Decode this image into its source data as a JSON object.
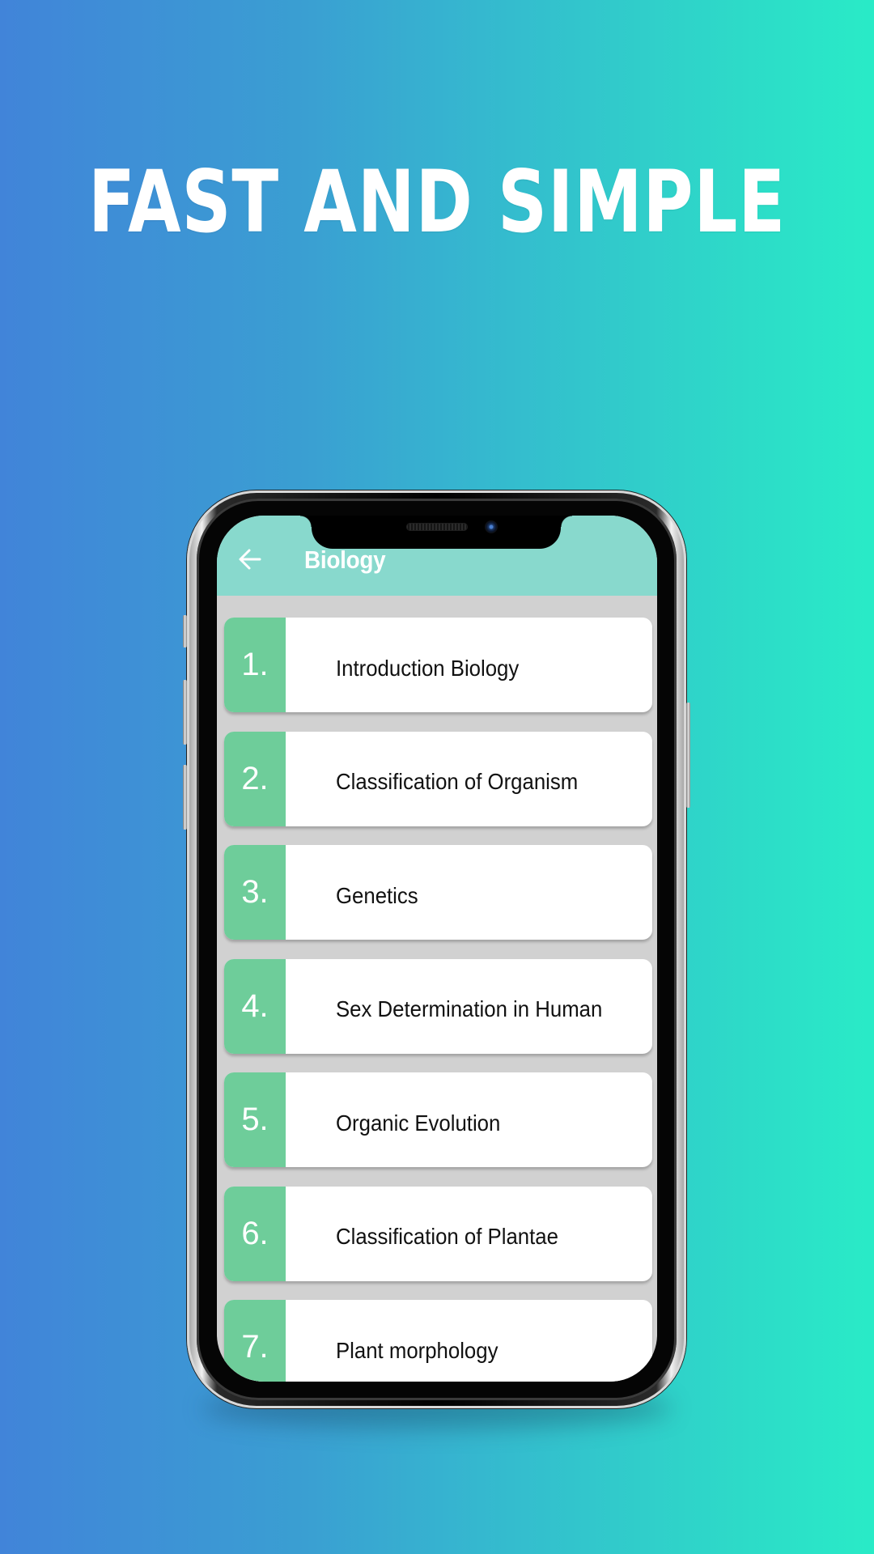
{
  "promo": {
    "headline": "FAST AND SIMPLE"
  },
  "colors": {
    "background_gradient": [
      "#4184d9",
      "#38acd0",
      "#29ebc7"
    ],
    "header_bg": "#88d9cd",
    "list_bg": "#d1d1d1",
    "number_bg": "#6ecd9a",
    "card_bg": "#ffffff",
    "title_text": "#ffffff",
    "item_text": "#111111"
  },
  "app": {
    "header": {
      "back_icon": "arrow-left-icon",
      "title": "Biology"
    },
    "chapters": [
      {
        "number": "1.",
        "title": "Introduction Biology"
      },
      {
        "number": "2.",
        "title": "Classification of Organism"
      },
      {
        "number": "3.",
        "title": "Genetics"
      },
      {
        "number": "4.",
        "title": "Sex Determination in Human"
      },
      {
        "number": "5.",
        "title": "Organic Evolution"
      },
      {
        "number": "6.",
        "title": "Classification of Plantae"
      },
      {
        "number": "7.",
        "title": "Plant morphology"
      }
    ]
  }
}
